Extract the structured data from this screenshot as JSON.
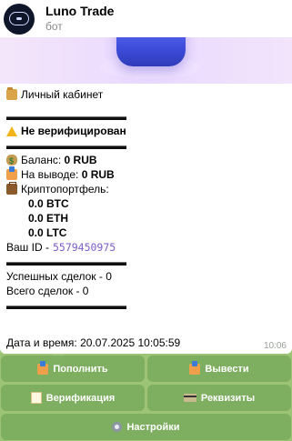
{
  "chat": {
    "title": "Luno Trade",
    "subtitle": "бот"
  },
  "message": {
    "cabinet": "Личный кабинет",
    "divider": "▬▬▬▬▬▬▬▬▬▬▬",
    "status": "Не верифицирован",
    "balance_label": "Баланс:",
    "balance_value": "0 RUB",
    "withdraw_label": "На выводе:",
    "withdraw_value": "0 RUB",
    "portfolio_label": "Криптопортфель:",
    "btc": "0.0 BTC",
    "eth": "0.0 ETH",
    "ltc": "0.0 LTC",
    "id_label": "Ваш  ID -",
    "id_value": "5579450975",
    "success_deals": "Успешных сделок - 0",
    "total_deals": "Всего сделок - 0",
    "datetime": "Дата и время: 20.07.2025 10:05:59",
    "time": "10:06"
  },
  "keyboard": {
    "deposit": "Пополнить",
    "withdraw": "Вывести",
    "verification": "Верификация",
    "requisites": "Реквизиты",
    "settings": "Настройки"
  },
  "icons": {
    "cabinet": "folder-icon",
    "status": "warning-icon",
    "balance": "money-bag-icon",
    "withdraw": "outbox-tray-icon",
    "portfolio": "briefcase-icon",
    "deposit": "inbox-tray-icon",
    "withdraw_btn": "outbox-tray-icon",
    "verification": "memo-icon",
    "requisites": "credit-card-icon",
    "settings": "gear-icon"
  },
  "colors": {
    "id_link": "#7a5cc9",
    "keyboard_button": "#78aa5a",
    "chat_background": "#9cc474"
  }
}
